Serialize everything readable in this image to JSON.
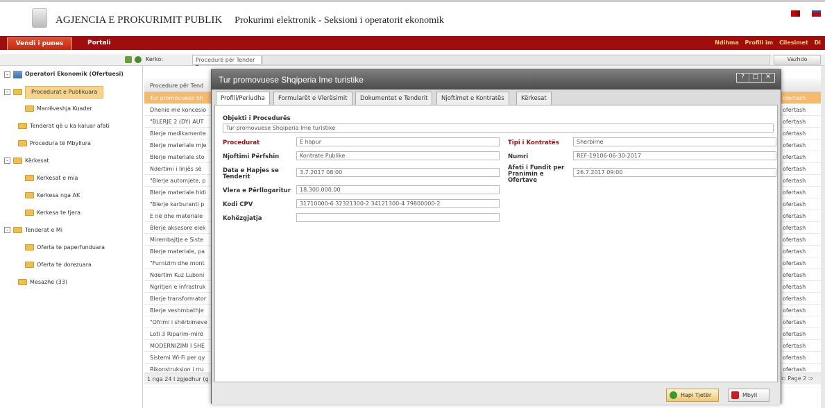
{
  "header": {
    "org": "AGJENCIA E PROKURIMIT PUBLIK",
    "subtitle": "Prokurimi elektronik - Seksioni i operatorit ekonomik"
  },
  "nav": {
    "tabs": [
      "Vendi i punes",
      "Portali"
    ],
    "right_links": [
      "Ndihma",
      "Profili im",
      "Cilesimet",
      "Di"
    ]
  },
  "toolbar": {
    "search_label": "Kerko:",
    "search_select": "Procedurë për Tender",
    "continue_label": "Vazhdo"
  },
  "sidebar": {
    "items": [
      {
        "label": "Operatori Ekonomik (Ofertuesi)",
        "level": 0,
        "toggle": "-",
        "root": true
      },
      {
        "label": "Procedurat e Publikuara",
        "level": 1,
        "toggle": "-",
        "selected": true
      },
      {
        "label": "Marrëveshja Kuader",
        "level": 2
      },
      {
        "label": "Tenderat që u ka kaluar afati",
        "level": 1
      },
      {
        "label": "Procedura të Mbyllura",
        "level": 1
      },
      {
        "label": "Kërkesat",
        "level": 1,
        "toggle": "-"
      },
      {
        "label": "Kerkesat e mia",
        "level": 2
      },
      {
        "label": "Kerkesa nga AK",
        "level": 2
      },
      {
        "label": "Kerkesa te tjera",
        "level": 2
      },
      {
        "label": "Tenderat e Mi",
        "level": 1,
        "toggle": "-"
      },
      {
        "label": "Oferta te paperfunduara",
        "level": 2
      },
      {
        "label": "Oferta te dorezuara",
        "level": 2
      },
      {
        "label": "Mesazhe (33)",
        "level": 1
      }
    ]
  },
  "grid": {
    "header": "Procedure për Tend",
    "rows": [
      {
        "left": "Tur promovuese Sh",
        "right": "ofertash",
        "selected": true
      },
      {
        "left": "Dhenie me koncesio",
        "right": "ofertash"
      },
      {
        "left": "\"BLERJE 2 (DY) AUT",
        "right": "ofertash"
      },
      {
        "left": "Blerje medikamente",
        "right": "ofertash"
      },
      {
        "left": "Blerje materiale mje",
        "right": "ofertash"
      },
      {
        "left": "Blerje materiale sto",
        "right": "ofertash"
      },
      {
        "left": "Ndertimi i linjës së",
        "right": "ofertash"
      },
      {
        "left": "\"Blerje automjete, p",
        "right": "ofertash"
      },
      {
        "left": "Blerje materiale hidi",
        "right": "ofertash"
      },
      {
        "left": "\"Blerje karburanti p",
        "right": "ofertash"
      },
      {
        "left": "E në dhe materiale",
        "right": "ofertash"
      },
      {
        "left": "Blerje aksesore elek",
        "right": "ofertash"
      },
      {
        "left": "Mirembajtje e Siste",
        "right": "ofertash"
      },
      {
        "left": "Blerje materiale, pa",
        "right": "ofertash"
      },
      {
        "left": "\"Furnizim dhe mont",
        "right": "ofertash"
      },
      {
        "left": "Ndertim Kuz Luboni",
        "right": "ofertash"
      },
      {
        "left": "Ngritjen e infrastruk",
        "right": "ofertash"
      },
      {
        "left": "Blerje transformator",
        "right": "ofertash"
      },
      {
        "left": "Blerje veshmbathje",
        "right": "ofertash"
      },
      {
        "left": "\"Ofrimi i shërbimeve",
        "right": "ofertash"
      },
      {
        "left": "Loti 3 Riparim-mirë",
        "right": "ofertash"
      },
      {
        "left": "MODERNIZIMI I SHE",
        "right": "ofertash"
      },
      {
        "left": "Sistemi Wi-Fi per qy",
        "right": "ofertash"
      },
      {
        "left": "Rikonstruksion i rru",
        "right": "ofertash"
      }
    ],
    "footer": "1 nga 24 I zgjedhur (g",
    "page": "Page 2"
  },
  "modal": {
    "title": "Tur promovuese Shqiperia Ime turistike",
    "tabs": [
      "Profili/Periudha",
      "Formularët e Vlerësimit",
      "Dokumentet e Tenderit",
      "Njoftimet e Kontratës",
      "Kërkesat"
    ],
    "section_title": "Objekti i Procedurës",
    "object_value": "Tur promovuese Shqiperia Ime turistike",
    "fields": {
      "procedurat_label": "Procedurat",
      "procedurat_value": "E hapur",
      "njoftimi_label": "Njoftimi Përfshin",
      "njoftimi_value": "Kontrate Publike",
      "data_label": "Data e Hapjes se Tenderit",
      "data_value": "3.7.2017 08:00",
      "vlera_label": "Vlera e Përllogaritur",
      "vlera_value": "18.300.000,00",
      "cpv_label": "Kodi CPV",
      "cpv_value": "31710000-6 32321300-2 34121300-4 79800000-2",
      "kohezgjatja_label": "Kohëzgjatja",
      "kohezgjatja_value": "",
      "tipi_label": "Tipi i Kontratës",
      "tipi_value": "Sherbime",
      "numri_label": "Numri",
      "numri_value": "REF-19106-06-30-2017",
      "afati_label": "Afati i Fundit per Pranimin e Ofertave",
      "afati_value": "26.7.2017 09:00"
    },
    "buttons": {
      "next": "Hapi Tjetër",
      "close": "Mbyll"
    }
  },
  "colors": {
    "nav_red": "#a00d0d",
    "selected_row": "#f7b96b",
    "label_red": "#9c1010"
  }
}
